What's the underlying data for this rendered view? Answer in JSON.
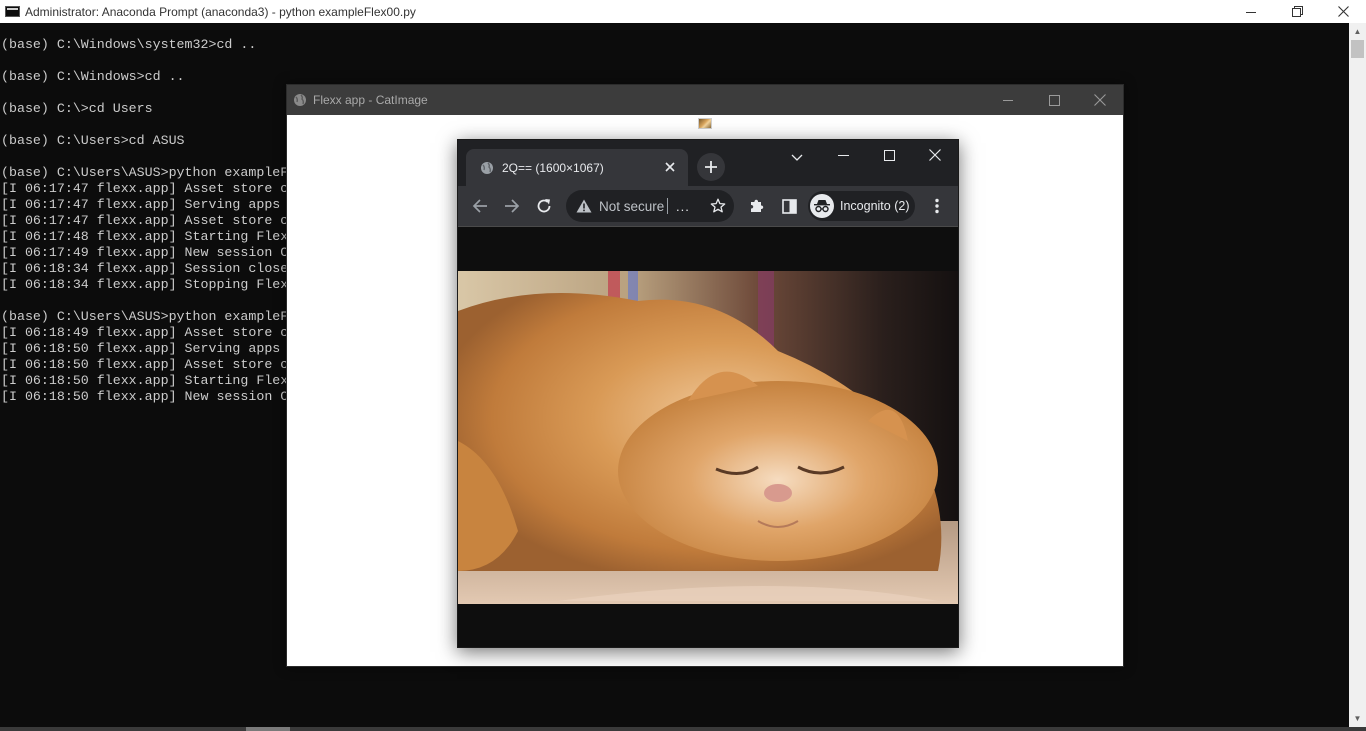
{
  "console": {
    "title": "Administrator: Anaconda Prompt (anaconda3) - python  exampleFlex00.py",
    "lines": [
      "(base) C:\\Windows\\system32>cd ..",
      "",
      "(base) C:\\Windows>cd ..",
      "",
      "(base) C:\\>cd Users",
      "",
      "(base) C:\\Users>cd ASUS",
      "",
      "(base) C:\\Users\\ASUS>python exampleF",
      "[I 06:17:47 flexx.app] Asset store c",
      "[I 06:17:47 flexx.app] Serving apps",
      "[I 06:17:47 flexx.app] Asset store c",
      "[I 06:17:48 flexx.app] Starting Flex",
      "[I 06:17:49 flexx.app] New session C",
      "[I 06:18:34 flexx.app] Session close",
      "[I 06:18:34 flexx.app] Stopping Flex",
      "",
      "(base) C:\\Users\\ASUS>python exampleF",
      "[I 06:18:49 flexx.app] Asset store c",
      "[I 06:18:50 flexx.app] Serving apps",
      "[I 06:18:50 flexx.app] Asset store c",
      "[I 06:18:50 flexx.app] Starting Flex",
      "[I 06:18:50 flexx.app] New session C"
    ],
    "controls": {
      "minimize_icon": "minimize-icon",
      "restore_icon": "restore-icon",
      "close_icon": "close-icon"
    }
  },
  "flexx_window": {
    "title": "Flexx app - CatImage",
    "controls": {
      "minimize_icon": "minimize-icon",
      "maximize_icon": "maximize-icon",
      "close_icon": "close-icon"
    }
  },
  "browser": {
    "tab_title": "2Q== (1600×1067)",
    "address": {
      "security_label": "Not secure",
      "url_truncated": "..."
    },
    "incognito_label": "Incognito (2)",
    "icons": {
      "back": "back-arrow-icon",
      "forward": "forward-arrow-icon",
      "reload": "reload-icon",
      "bookmark": "star-icon",
      "extensions": "puzzle-icon",
      "side_panel": "side-panel-icon",
      "menu": "kebab-menu-icon",
      "new_tab": "plus-icon",
      "tab_search": "chevron-down-icon"
    },
    "image_subject": "sleeping orange persian cat"
  },
  "colors": {
    "console_bg": "#0c0c0c",
    "console_text": "#cccccc",
    "flexx_titlebar": "#3c3c3c",
    "chrome_frame": "#202124",
    "chrome_toolbar": "#35363a"
  }
}
